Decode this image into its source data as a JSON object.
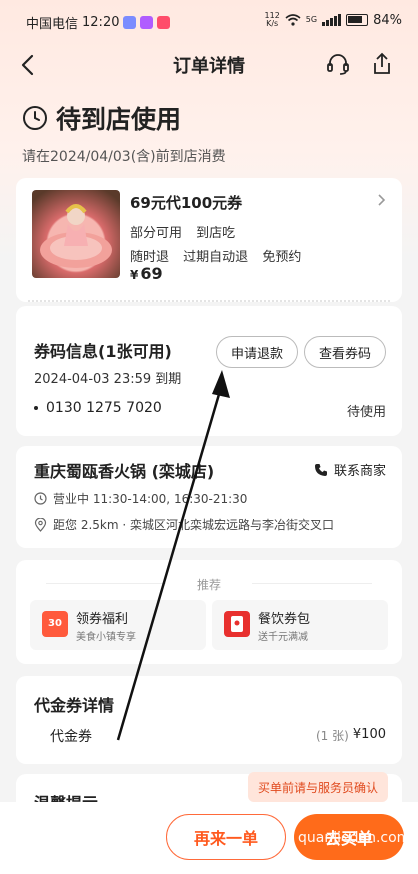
{
  "status_bar": {
    "carrier": "中国电信",
    "time": "12:20",
    "net_speed": "112",
    "net_unit": "K/s",
    "network_type": "5G",
    "battery": "84%"
  },
  "header": {
    "title": "订单详情",
    "back_icon": "chevron-left-icon",
    "service_icon": "headset-icon",
    "share_icon": "share-icon"
  },
  "order_status": {
    "title": "待到店使用",
    "subtitle": "请在2024/04/03(含)前到店消费"
  },
  "deal": {
    "title": "69元代100元券",
    "tags_line1": [
      "部分可用",
      "到店吃"
    ],
    "tags_line2": [
      "随时退",
      "过期自动退",
      "免预约"
    ],
    "currency": "¥",
    "price": "69"
  },
  "coupon": {
    "title": "券码信息(1张可用)",
    "expire": "2024-04-03 23:59 到期",
    "refund_label": "申请退款",
    "view_label": "查看券码",
    "code": "0130 1275 7020",
    "status": "待使用"
  },
  "store": {
    "name": "重庆蜀瓯香火锅 (栾城店)",
    "contact_label": "联系商家",
    "hours": "营业中 11:30-14:00, 16:30-21:30",
    "address": "距您 2.5km · 栾城区河北栾城宏远路与李冶街交叉口"
  },
  "recommend": {
    "label": "推荐",
    "items": [
      {
        "name": "领券福利",
        "desc": "美食小镇专享",
        "badge": "30",
        "color": "#ff5a3c"
      },
      {
        "name": "餐饮券包",
        "desc": "送千元满减",
        "badge": "",
        "color": "#e8302e"
      }
    ]
  },
  "voucher_detail": {
    "title": "代金券详情",
    "name": "代金券",
    "qty": "(1 张)",
    "price": "¥100"
  },
  "tips": {
    "title": "温馨提示",
    "toast": "买单前请与服务员确认"
  },
  "bottom": {
    "again_label": "再来一单",
    "buy_label": "去买单"
  },
  "watermark": "quanjiedan.com",
  "colors": {
    "accent": "#ff6b1a",
    "accent_text": "#ff5a1f"
  }
}
